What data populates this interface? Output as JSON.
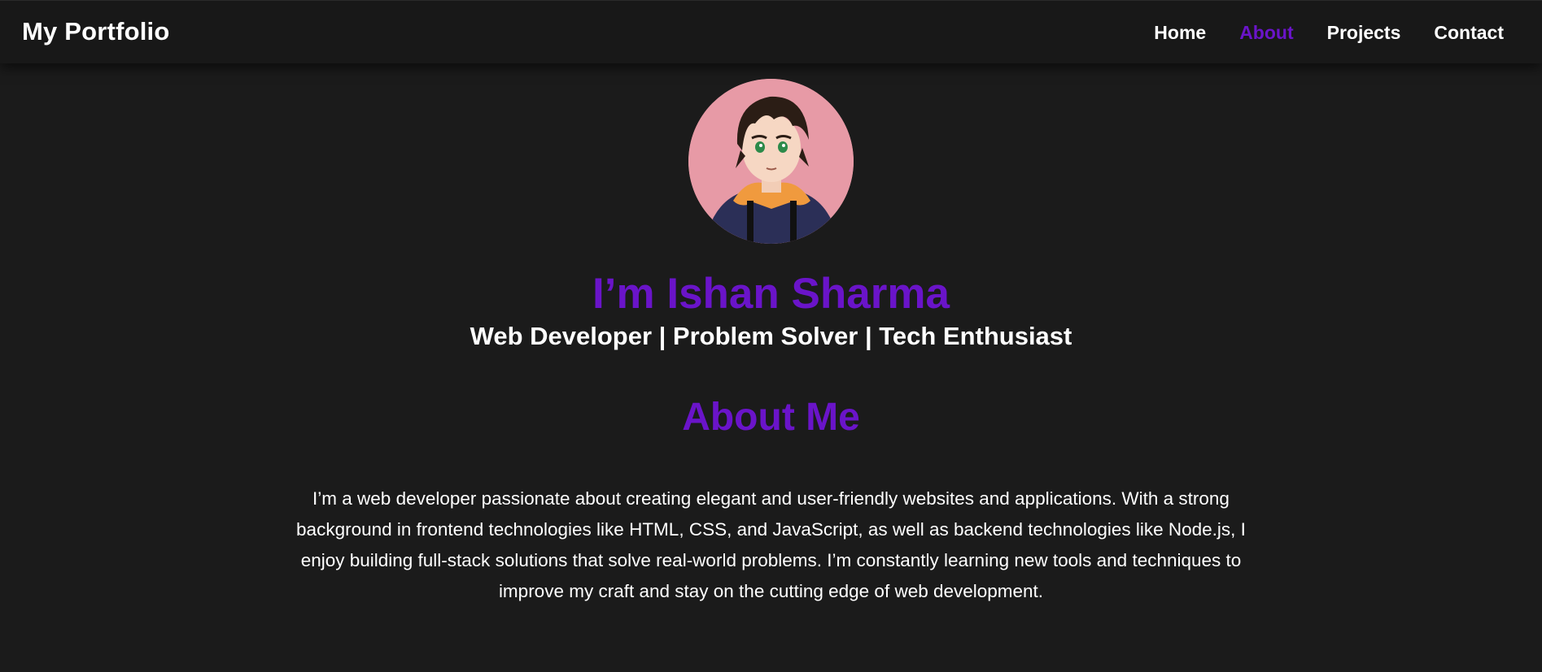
{
  "nav": {
    "brand": "My Portfolio",
    "links": [
      {
        "label": "Home",
        "active": false
      },
      {
        "label": "About",
        "active": true
      },
      {
        "label": "Projects",
        "active": false
      },
      {
        "label": "Contact",
        "active": false
      }
    ]
  },
  "hero": {
    "avatar_icon": "avatar-portrait",
    "headline": "I’m Ishan Sharma",
    "tagline": "Web Developer | Problem Solver | Tech Enthusiast"
  },
  "about": {
    "title": "About Me",
    "text": "I’m a web developer passionate about creating elegant and user-friendly websites and applications. With a strong background in frontend technologies like HTML, CSS, and JavaScript, as well as backend technologies like Node.js, I enjoy building full-stack solutions that solve real-world problems. I’m constantly learning new tools and techniques to improve my craft and stay on the cutting edge of web development."
  },
  "colors": {
    "background": "#1b1b1b",
    "navbar": "#181818",
    "accent": "#6a14c9",
    "text": "#ffffff"
  }
}
